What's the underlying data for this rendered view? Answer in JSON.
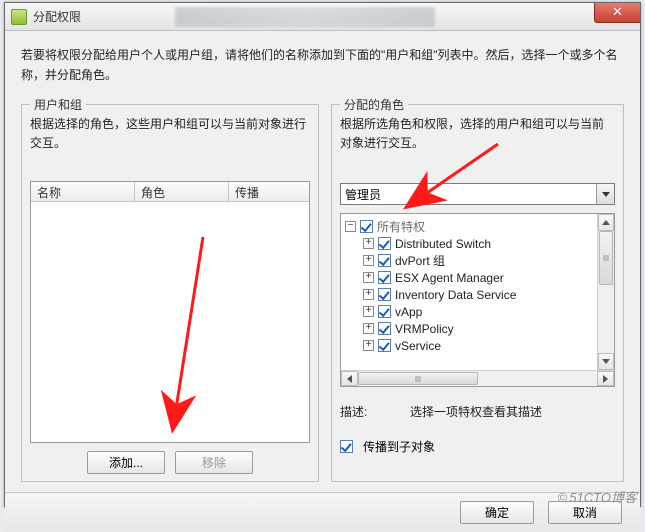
{
  "window": {
    "title": "分配权限",
    "close_icon": "✕"
  },
  "intro": "若要将权限分配给用户个人或用户组，请将他们的名称添加到下面的\"用户和组\"列表中。然后，选择一个或多个名称，并分配角色。",
  "left_panel": {
    "legend": "用户和组",
    "desc": "根据选择的角色，这些用户和组可以与当前对象进行交互。",
    "columns": {
      "name": "名称",
      "role": "角色",
      "propagate": "传播"
    },
    "add_label": "添加...",
    "remove_label": "移除"
  },
  "right_panel": {
    "legend": "分配的角色",
    "desc": "根据所选角色和权限，选择的用户和组可以与当前对象进行交互。",
    "role_selected": "管理员",
    "tree": {
      "root": {
        "expander": "−",
        "label": "所有特权"
      },
      "children": [
        {
          "label": "Distributed Switch"
        },
        {
          "label": "dvPort 组"
        },
        {
          "label": "ESX Agent Manager"
        },
        {
          "label": "Inventory Data Service"
        },
        {
          "label": "vApp"
        },
        {
          "label": "VRMPolicy"
        },
        {
          "label": "vService"
        }
      ],
      "child_expander": "+"
    },
    "description_label": "描述:",
    "description_value": "选择一项特权查看其描述",
    "propagate_label": "传播到子对象"
  },
  "footer": {
    "ok": "确定",
    "cancel": "取消"
  },
  "watermark": "51CTO博客"
}
